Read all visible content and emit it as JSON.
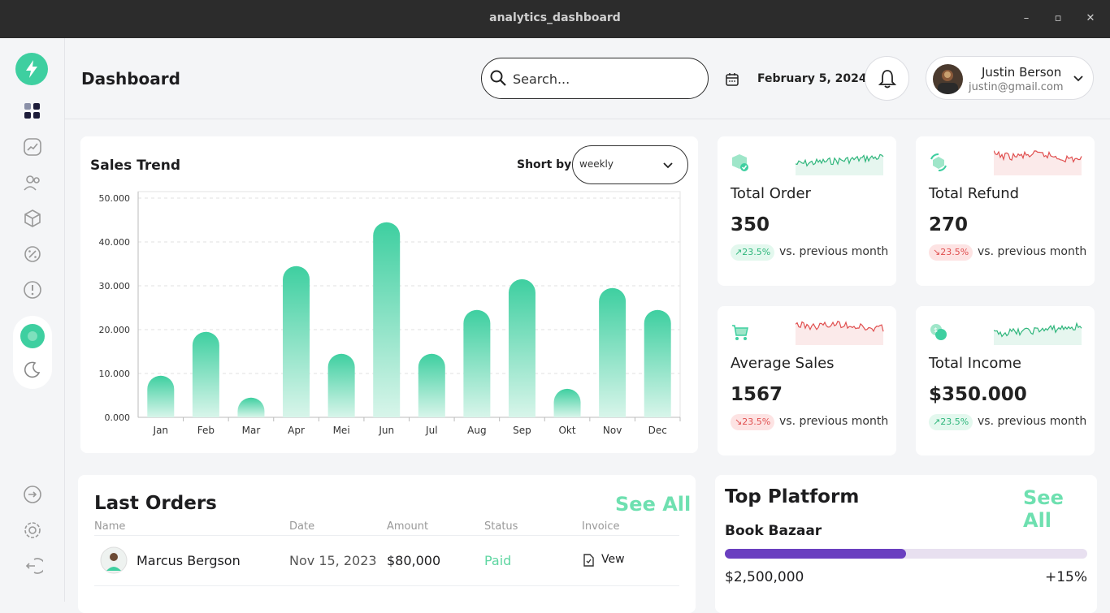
{
  "window": {
    "title": "analytics_dashboard",
    "minimize": "–",
    "maximize": "▫",
    "close": "✕"
  },
  "header": {
    "title": "Dashboard",
    "search_placeholder": "Search...",
    "date": "February 5, 2024",
    "user_name": "Justin Berson",
    "user_email": "justin@gmail.com"
  },
  "sidebar": {
    "items": [
      "dashboard-icon",
      "trend-icon",
      "users-icon",
      "box-icon",
      "discount-icon",
      "info-icon"
    ],
    "bottom": [
      "login-icon",
      "settings-icon",
      "logout-icon"
    ]
  },
  "sales": {
    "title": "Sales Trend",
    "sort_label": "Short by:",
    "sort_value": "weekly"
  },
  "chart_data": {
    "type": "bar",
    "categories": [
      "Jan",
      "Feb",
      "Mar",
      "Apr",
      "Mei",
      "Jun",
      "Jul",
      "Aug",
      "Sep",
      "Okt",
      "Nov",
      "Dec"
    ],
    "values": [
      9500,
      19500,
      4500,
      34500,
      14500,
      44500,
      14500,
      24500,
      31500,
      6500,
      29500,
      24500
    ],
    "yticks": [
      "0.000",
      "10.000",
      "20.000",
      "30.000",
      "40.000",
      "50.000"
    ],
    "ylim": [
      0,
      50000
    ],
    "grid": true,
    "colors": {
      "bar_top": "#3ecfa0",
      "bar_bottom": "#d8f5ea"
    }
  },
  "stats": [
    {
      "label": "Total Order",
      "value": "350",
      "change": "23.5%",
      "trend": "up",
      "vs": "vs. previous month"
    },
    {
      "label": "Total Refund",
      "value": "270",
      "change": "23.5%",
      "trend": "down",
      "vs": "vs. previous month"
    },
    {
      "label": "Average Sales",
      "value": "1567",
      "change": "23.5%",
      "trend": "down",
      "vs": "vs. previous month"
    },
    {
      "label": "Total Income",
      "value": "$350.000",
      "change": "23.5%",
      "trend": "up",
      "vs": "vs. previous month"
    }
  ],
  "orders": {
    "title": "Last Orders",
    "see_all": "See All",
    "columns": [
      "Name",
      "Date",
      "Amount",
      "Status",
      "Invoice"
    ],
    "rows": [
      {
        "name": "Marcus Bergson",
        "date": "Nov 15, 2023",
        "amount": "$80,000",
        "status": "Paid",
        "invoice": "Vew"
      }
    ]
  },
  "platform": {
    "title": "Top Platform",
    "see_all": "See All",
    "items": [
      {
        "name": "Book Bazaar",
        "amount": "$2,500,000",
        "change": "+15%",
        "progress": 0.5
      }
    ]
  },
  "colors": {
    "accent": "#3ecfa0",
    "up": "#2fb67c",
    "down": "#e04f4f",
    "purple": "#6a3fc0"
  }
}
